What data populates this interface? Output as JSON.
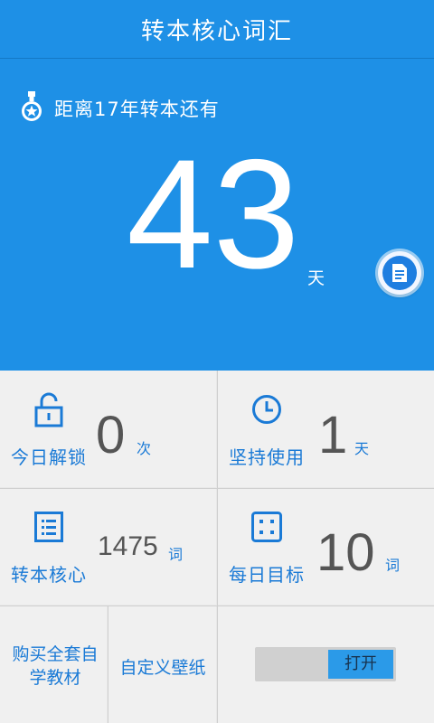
{
  "app": {
    "title": "转本核心词汇"
  },
  "countdown": {
    "label": "距离17年转本还有",
    "days": "43",
    "unit": "天"
  },
  "stats": {
    "unlock": {
      "label": "今日解锁",
      "value": "0",
      "unit": "次",
      "icon": "unlock-icon"
    },
    "persist": {
      "label": "坚持使用",
      "value": "1",
      "unit": "天",
      "icon": "clock-icon"
    },
    "core": {
      "label": "转本核心",
      "value": "1475",
      "unit": "词",
      "icon": "list-icon"
    },
    "goal": {
      "label": "每日目标",
      "value": "10",
      "unit": "词",
      "icon": "dice-icon"
    }
  },
  "actions": {
    "buy_line1": "购买全套自",
    "buy_line2": "学教材",
    "wallpaper": "自定义壁纸",
    "toggle_label": "打开"
  },
  "colors": {
    "brand_blue": "#1e90e6",
    "accent_text": "#1a7ad6",
    "tile_bg": "#f0f0f0"
  }
}
